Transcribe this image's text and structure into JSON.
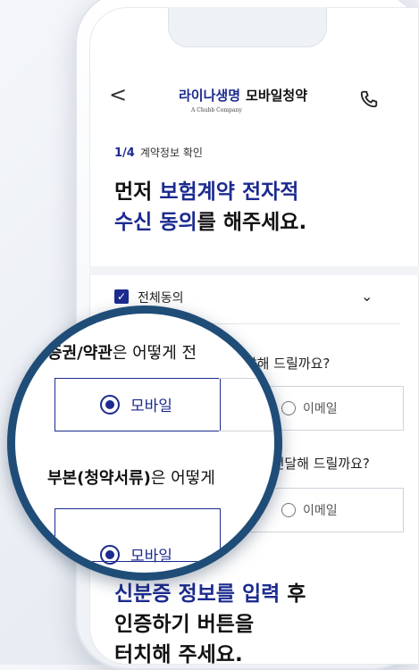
{
  "header": {
    "back_glyph": "<",
    "brand": "라이나생명",
    "service": "모바일청약",
    "brand_sub": "A Chubb Company",
    "phone_icon": "phone-icon"
  },
  "step": {
    "current": "1/4",
    "label": "계약정보 확인"
  },
  "title": {
    "l1a": "먼저 ",
    "l1b": "보험계약 전자적",
    "l2a": "수신 동의",
    "l2b": "를 해주세요."
  },
  "agree_all": {
    "label": "전체동의",
    "checked": true
  },
  "q1": {
    "text": "전달해 드릴까요?",
    "mag_bold": "증권/약관",
    "mag_rest": "은 어떻게 전",
    "selected": "모바일",
    "other": "이메일"
  },
  "q2": {
    "text": "게 전달해 드릴까요?",
    "mag_bold": "부본(청약서류)",
    "mag_rest": "은 어떻게",
    "selected": "모바일",
    "other": "이메일"
  },
  "cta": {
    "l1a": "신분증 정보를 입력",
    "l1b": " 후",
    "l2": "인증하기 버튼을",
    "l3": "터치해 주세요."
  },
  "colors": {
    "brand": "#1c2b8f",
    "magnifier_ring": "#1f4d78"
  }
}
